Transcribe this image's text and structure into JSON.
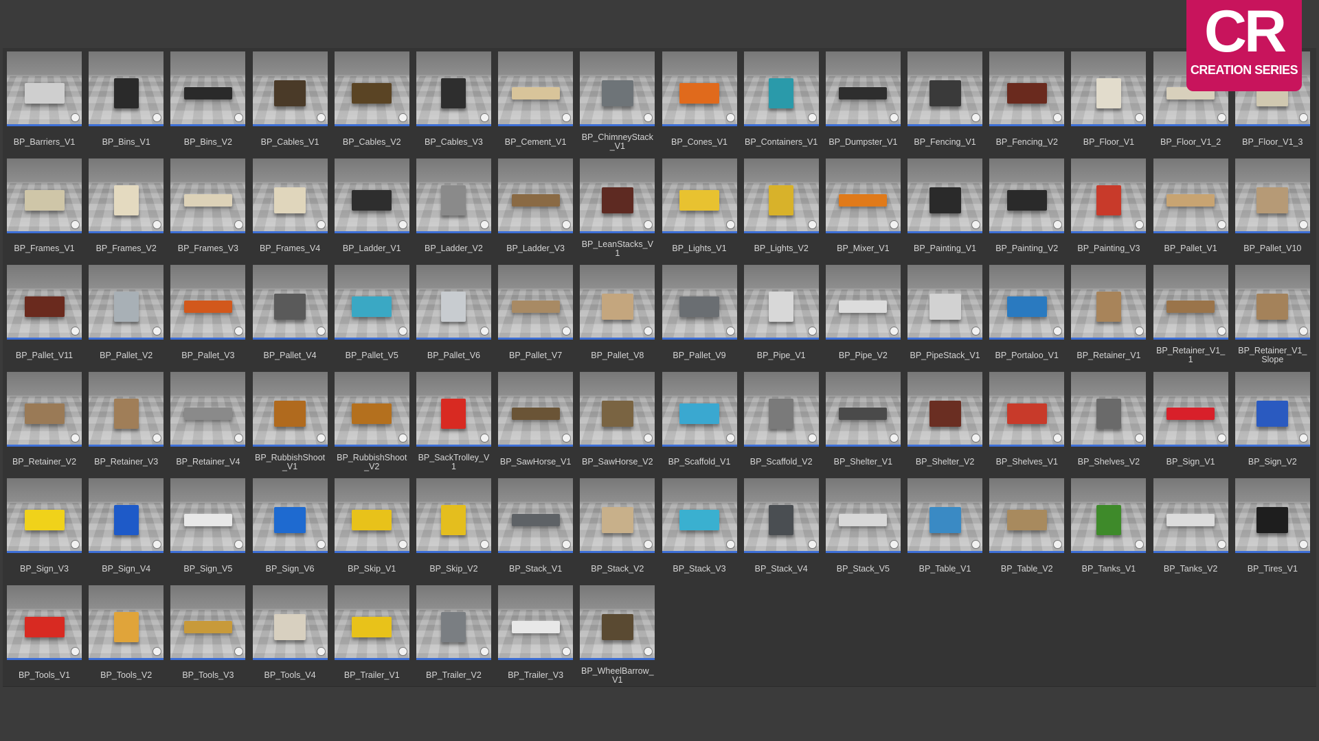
{
  "logo": {
    "mark": "CR",
    "subtitle": "CREATION SERIES"
  },
  "colors": {
    "accent": "#3d6fd6",
    "brand": "#c8145c",
    "background": "#3b3b3b"
  },
  "assets": [
    {
      "label": "BP_Barriers_V1",
      "color": "#cfcfcf"
    },
    {
      "label": "BP_Bins_V1",
      "color": "#2a2a2a"
    },
    {
      "label": "BP_Bins_V2",
      "color": "#2a2a2a"
    },
    {
      "label": "BP_Cables_V1",
      "color": "#4a3a28"
    },
    {
      "label": "BP_Cables_V2",
      "color": "#5a4424"
    },
    {
      "label": "BP_Cables_V3",
      "color": "#2e2e2e"
    },
    {
      "label": "BP_Cement_V1",
      "color": "#d8c49a"
    },
    {
      "label": "BP_ChimneyStack_V1",
      "color": "#6e7478"
    },
    {
      "label": "BP_Cones_V1",
      "color": "#e06a1c"
    },
    {
      "label": "BP_Containers_V1",
      "color": "#2a9aaa"
    },
    {
      "label": "BP_Dumpster_V1",
      "color": "#2e2e2e"
    },
    {
      "label": "BP_Fencing_V1",
      "color": "#3a3a3a"
    },
    {
      "label": "BP_Fencing_V2",
      "color": "#6a2a1e"
    },
    {
      "label": "BP_Floor_V1",
      "color": "#e2dccc"
    },
    {
      "label": "BP_Floor_V1_2",
      "color": "#d8d0bc"
    },
    {
      "label": "BP_Floor_V1_3",
      "color": "#d0c8b0"
    },
    {
      "label": "BP_Frames_V1",
      "color": "#cfc6a8"
    },
    {
      "label": "BP_Frames_V2",
      "color": "#e4dac0"
    },
    {
      "label": "BP_Frames_V3",
      "color": "#ddd2b8"
    },
    {
      "label": "BP_Frames_V4",
      "color": "#e0d6bc"
    },
    {
      "label": "BP_Ladder_V1",
      "color": "#2e2e2e"
    },
    {
      "label": "BP_Ladder_V2",
      "color": "#8a8a8a"
    },
    {
      "label": "BP_Ladder_V3",
      "color": "#8a6a44"
    },
    {
      "label": "BP_LeanStacks_V1",
      "color": "#5e2a22"
    },
    {
      "label": "BP_Lights_V1",
      "color": "#e8c230"
    },
    {
      "label": "BP_Lights_V2",
      "color": "#d8b22a"
    },
    {
      "label": "BP_Mixer_V1",
      "color": "#e07a1a"
    },
    {
      "label": "BP_Painting_V1",
      "color": "#2a2a2a"
    },
    {
      "label": "BP_Painting_V2",
      "color": "#2a2a2a"
    },
    {
      "label": "BP_Painting_V3",
      "color": "#c83a2a"
    },
    {
      "label": "BP_Pallet_V1",
      "color": "#c8a472"
    },
    {
      "label": "BP_Pallet_V10",
      "color": "#b69a76"
    },
    {
      "label": "BP_Pallet_V11",
      "color": "#6a2a1e"
    },
    {
      "label": "BP_Pallet_V2",
      "color": "#a8b0b6"
    },
    {
      "label": "BP_Pallet_V3",
      "color": "#d2581c"
    },
    {
      "label": "BP_Pallet_V4",
      "color": "#5a5a5a"
    },
    {
      "label": "BP_Pallet_V5",
      "color": "#3aa8c4"
    },
    {
      "label": "BP_Pallet_V6",
      "color": "#c8ccd0"
    },
    {
      "label": "BP_Pallet_V7",
      "color": "#a88a64"
    },
    {
      "label": "BP_Pallet_V8",
      "color": "#c4a67e"
    },
    {
      "label": "BP_Pallet_V9",
      "color": "#6a6e72"
    },
    {
      "label": "BP_Pipe_V1",
      "color": "#d8d8d8"
    },
    {
      "label": "BP_Pipe_V2",
      "color": "#dcdcdc"
    },
    {
      "label": "BP_PipeStack_V1",
      "color": "#d2d2d2"
    },
    {
      "label": "BP_Portaloo_V1",
      "color": "#2a7ac0"
    },
    {
      "label": "BP_Retainer_V1",
      "color": "#a8845a"
    },
    {
      "label": "BP_Retainer_V1_1",
      "color": "#9a744a"
    },
    {
      "label": "BP_Retainer_V1_Slope",
      "color": "#a4825a"
    },
    {
      "label": "BP_Retainer_V2",
      "color": "#9a7a56"
    },
    {
      "label": "BP_Retainer_V3",
      "color": "#a07e58"
    },
    {
      "label": "BP_Retainer_V4",
      "color": "#8a8a8a"
    },
    {
      "label": "BP_RubbishShoot_V1",
      "color": "#b06a1e"
    },
    {
      "label": "BP_RubbishShoot_V2",
      "color": "#b4701e"
    },
    {
      "label": "BP_SackTrolley_V1",
      "color": "#d82a22"
    },
    {
      "label": "BP_SawHorse_V1",
      "color": "#6a5436"
    },
    {
      "label": "BP_SawHorse_V2",
      "color": "#7a6442"
    },
    {
      "label": "BP_Scaffold_V1",
      "color": "#3aa8d0"
    },
    {
      "label": "BP_Scaffold_V2",
      "color": "#7a7a7a"
    },
    {
      "label": "BP_Shelter_V1",
      "color": "#4a4a4a"
    },
    {
      "label": "BP_Shelter_V2",
      "color": "#6a2e22"
    },
    {
      "label": "BP_Shelves_V1",
      "color": "#c83a2a"
    },
    {
      "label": "BP_Shelves_V2",
      "color": "#6a6a6a"
    },
    {
      "label": "BP_Sign_V1",
      "color": "#d8202a"
    },
    {
      "label": "BP_Sign_V2",
      "color": "#2a5ac0"
    },
    {
      "label": "BP_Sign_V3",
      "color": "#f0d21a"
    },
    {
      "label": "BP_Sign_V4",
      "color": "#1e5ac8"
    },
    {
      "label": "BP_Sign_V5",
      "color": "#e8e8e8"
    },
    {
      "label": "BP_Sign_V6",
      "color": "#1e6ad0"
    },
    {
      "label": "BP_Skip_V1",
      "color": "#e8c21a"
    },
    {
      "label": "BP_Skip_V2",
      "color": "#e4be1e"
    },
    {
      "label": "BP_Stack_V1",
      "color": "#5e6266"
    },
    {
      "label": "BP_Stack_V2",
      "color": "#c8b08a"
    },
    {
      "label": "BP_Stack_V3",
      "color": "#3ab0d0"
    },
    {
      "label": "BP_Stack_V4",
      "color": "#4a4e52"
    },
    {
      "label": "BP_Stack_V5",
      "color": "#d8d8d8"
    },
    {
      "label": "BP_Table_V1",
      "color": "#3a8ac4"
    },
    {
      "label": "BP_Table_V2",
      "color": "#a88a5e"
    },
    {
      "label": "BP_Tanks_V1",
      "color": "#3e8a2a"
    },
    {
      "label": "BP_Tanks_V2",
      "color": "#dcdcdc"
    },
    {
      "label": "BP_Tires_V1",
      "color": "#1e1e1e"
    },
    {
      "label": "BP_Tools_V1",
      "color": "#d82a22"
    },
    {
      "label": "BP_Tools_V2",
      "color": "#e0a43a"
    },
    {
      "label": "BP_Tools_V3",
      "color": "#c89a3a"
    },
    {
      "label": "BP_Tools_V4",
      "color": "#d8d0c0"
    },
    {
      "label": "BP_Trailer_V1",
      "color": "#e8c21a"
    },
    {
      "label": "BP_Trailer_V2",
      "color": "#7a7e82"
    },
    {
      "label": "BP_Trailer_V3",
      "color": "#e8e8e8"
    },
    {
      "label": "BP_WheelBarrow_V1",
      "color": "#5a4a32"
    }
  ]
}
